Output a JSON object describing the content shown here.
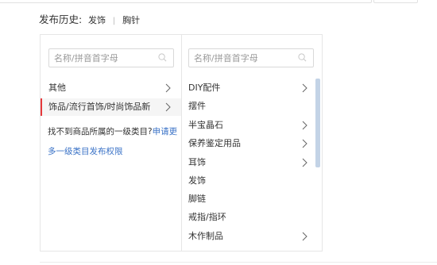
{
  "history": {
    "label": "发布历史:",
    "items": [
      "发饰",
      "胸针"
    ],
    "separator": "|"
  },
  "left_column": {
    "search_placeholder": "名称/拼音首字母",
    "items": [
      {
        "label": "其他",
        "has_children": true,
        "active": false
      },
      {
        "label": "饰品/流行首饰/时尚饰品新",
        "has_children": true,
        "active": true
      }
    ],
    "hint_text": "找不到商品所属的一级类目?",
    "hint_link": "申请更",
    "more_link": "多一级类目发布权限"
  },
  "right_column": {
    "search_placeholder": "名称/拼音首字母",
    "items": [
      {
        "label": "DIY配件",
        "has_children": true
      },
      {
        "label": "摆件",
        "has_children": false
      },
      {
        "label": "半宝晶石",
        "has_children": true
      },
      {
        "label": "保养鉴定用品",
        "has_children": true
      },
      {
        "label": "耳饰",
        "has_children": true
      },
      {
        "label": "发饰",
        "has_children": false
      },
      {
        "label": "脚链",
        "has_children": false
      },
      {
        "label": "戒指/指环",
        "has_children": false
      },
      {
        "label": "木作制品",
        "has_children": true
      }
    ]
  },
  "colors": {
    "active_marker": "#e5383b",
    "link": "#3b73c7",
    "scrollbar": "#c3d3e6"
  }
}
